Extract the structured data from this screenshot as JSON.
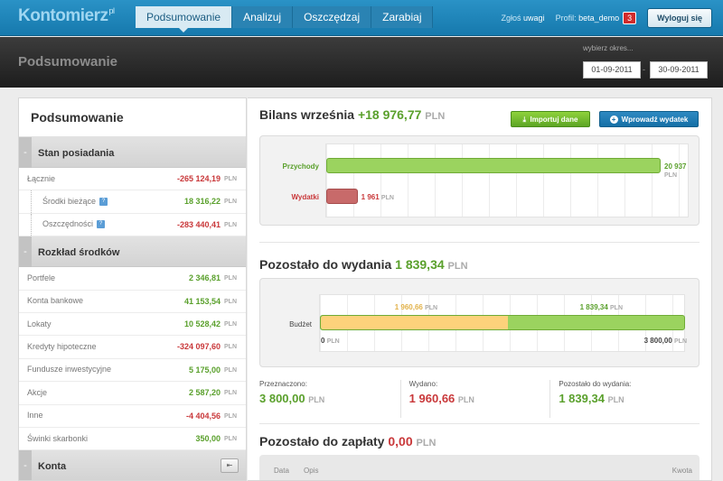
{
  "app": {
    "logo": "Kontomierz",
    "logo_suffix": "pl"
  },
  "nav": {
    "items": [
      {
        "label": "Podsumowanie"
      },
      {
        "label": "Analizuj"
      },
      {
        "label": "Oszczędzaj"
      },
      {
        "label": "Zarabiaj"
      }
    ]
  },
  "topright": {
    "feedback_prefix": "Zgłoś",
    "feedback": "uwagi",
    "profile_prefix": "Profil:",
    "profile_name": "beta_demo",
    "notifications": "3",
    "logout": "Wyloguj się"
  },
  "header": {
    "title": "Podsumowanie",
    "period_label": "wybierz okres...",
    "date_from": "01-09-2011",
    "date_sep": "-",
    "date_to": "30-09-2011"
  },
  "sidebar": {
    "title": "Podsumowanie",
    "sections": [
      {
        "title": "Stan posiadania",
        "toggle": "-",
        "rows": [
          {
            "label": "Łącznie",
            "value": "-265 124,19",
            "currency": "PLN",
            "sign": "neg"
          },
          {
            "label": "Środki bieżące",
            "value": "18 316,22",
            "currency": "PLN",
            "sign": "pos",
            "help": "?"
          },
          {
            "label": "Oszczędności",
            "value": "-283 440,41",
            "currency": "PLN",
            "sign": "neg",
            "help": "?"
          }
        ]
      },
      {
        "title": "Rozkład środków",
        "toggle": "-",
        "rows": [
          {
            "label": "Portfele",
            "value": "2 346,81",
            "currency": "PLN",
            "sign": "pos"
          },
          {
            "label": "Konta bankowe",
            "value": "41 153,54",
            "currency": "PLN",
            "sign": "pos"
          },
          {
            "label": "Lokaty",
            "value": "10 528,42",
            "currency": "PLN",
            "sign": "pos"
          },
          {
            "label": "Kredyty hipoteczne",
            "value": "-324 097,60",
            "currency": "PLN",
            "sign": "neg"
          },
          {
            "label": "Fundusze inwestycyjne",
            "value": "5 175,00",
            "currency": "PLN",
            "sign": "pos"
          },
          {
            "label": "Akcje",
            "value": "2 587,20",
            "currency": "PLN",
            "sign": "pos"
          },
          {
            "label": "Inne",
            "value": "-4 404,56",
            "currency": "PLN",
            "sign": "neg"
          },
          {
            "label": "Świnki skarbonki",
            "value": "350,00",
            "currency": "PLN",
            "sign": "pos"
          }
        ]
      },
      {
        "title": "Konta",
        "toggle": "-",
        "button": "⇤"
      }
    ]
  },
  "balance": {
    "title": "Bilans września",
    "amount": "+18 976,77",
    "currency": "PLN",
    "import_button": "Importuj dane",
    "import_icon": "download-icon",
    "add_button": "Wprowadź wydatek",
    "add_icon": "plus-icon",
    "chart": {
      "rows": [
        {
          "label": "Przychody",
          "value": 20937,
          "value_label": "20 937",
          "currency": "PLN",
          "color": "#9bd35f"
        },
        {
          "label": "Wydatki",
          "value": 1961,
          "value_label": "1 961",
          "currency": "PLN",
          "color": "#c86a6a"
        }
      ],
      "max": 20937
    }
  },
  "remaining": {
    "title": "Pozostało do wydania",
    "amount": "1 839,34",
    "currency": "PLN",
    "budget": {
      "label": "Budżet",
      "spent": 1960.66,
      "spent_label": "1 960,66",
      "spent_color": "#fdd27b",
      "remaining": 1839.34,
      "remaining_label": "1 839,34",
      "remaining_color": "#9bd35f",
      "total": 3800.0,
      "min_label": "0",
      "max_label": "3 800,00",
      "currency": "PLN"
    },
    "stats": [
      {
        "label": "Przeznaczono:",
        "value": "3 800,00",
        "currency": "PLN",
        "sign": "pos"
      },
      {
        "label": "Wydano:",
        "value": "1 960,66",
        "currency": "PLN",
        "sign": "neg"
      },
      {
        "label": "Pozostało do wydania:",
        "value": "1 839,34",
        "currency": "PLN",
        "sign": "pos"
      }
    ]
  },
  "topay": {
    "title": "Pozostało do zapłaty",
    "amount": "0,00",
    "currency": "PLN",
    "columns": [
      "Data",
      "Opis",
      "Kwota"
    ]
  }
}
